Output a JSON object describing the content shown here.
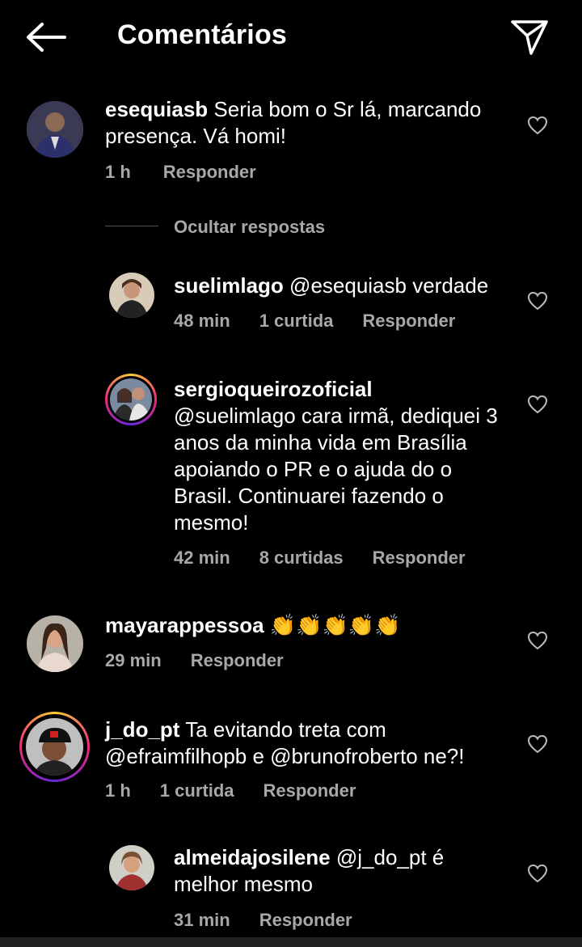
{
  "header": {
    "title": "Comentários",
    "back_icon": "arrow-left-icon",
    "send_icon": "paper-plane-icon"
  },
  "comments": [
    {
      "username": "esequiasb",
      "text": " Seria bom o Sr lá, marcando presença. Vá homi!",
      "time": "1 h",
      "reply": "Responder",
      "avatar": "avatar-esequiasb"
    },
    {
      "username": "suelimlago",
      "text": " @esequiasb verdade",
      "time": "48 min",
      "likes": "1 curtida",
      "reply": "Responder"
    },
    {
      "username": "sergioqueirozoficial",
      "text": "@suelimlago cara irmã, dediquei 3 anos da minha vida em Brasília apoiando o PR e o ajuda do o Brasil. Continuarei fazendo o mesmo!",
      "time": "42 min",
      "likes": "8 curtidas",
      "reply": "Responder"
    },
    {
      "username": "mayarappessoa",
      "text": " 👏👏👏👏👏",
      "time": "29 min",
      "reply": "Responder"
    },
    {
      "username": "j_do_pt",
      "text": " Ta evitando treta com @efraimfilhopb e @brunofroberto ne?!",
      "time": "1 h",
      "likes": "1 curtida",
      "reply": "Responder"
    },
    {
      "username": "almeidajosilene",
      "text": " @j_do_pt é melhor mesmo",
      "time": "31 min",
      "reply": "Responder"
    }
  ],
  "hide_replies": "Ocultar respostas",
  "colors": {
    "background": "#000000",
    "text": "#ffffff",
    "meta": "#a8a8a8",
    "mention": "#e0f1ff"
  }
}
